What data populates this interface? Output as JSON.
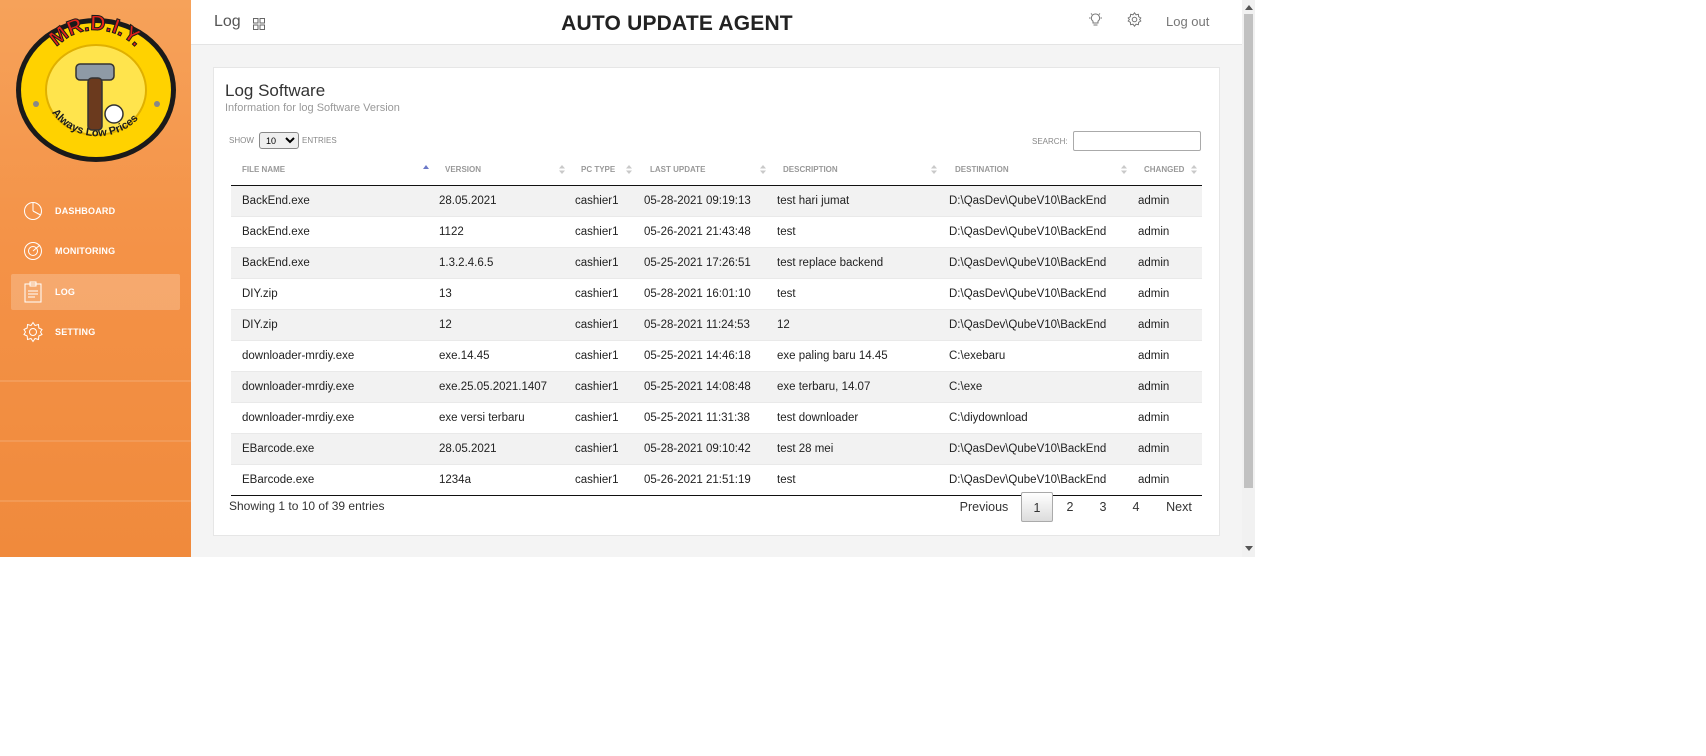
{
  "header": {
    "breadcrumb": "Log",
    "title": "AUTO UPDATE AGENT",
    "logout_label": "Log out"
  },
  "logo": {
    "top_text": "MR.D.I.Y.",
    "bottom_text": "Always Low Prices"
  },
  "sidebar": {
    "items": [
      {
        "label": "DASHBOARD",
        "icon": "pie-chart-icon",
        "active": false
      },
      {
        "label": "MONITORING",
        "icon": "target-icon",
        "active": false
      },
      {
        "label": "LOG",
        "icon": "clipboard-icon",
        "active": true
      },
      {
        "label": "SETTING",
        "icon": "gear-icon",
        "active": false
      }
    ]
  },
  "card": {
    "title": "Log Software",
    "subtitle": "Information for log Software Version",
    "show_label": "SHOW",
    "entries_value": "10",
    "entries_label": "ENTRIES",
    "search_label": "SEARCH:",
    "search_value": ""
  },
  "table": {
    "columns": [
      "FILE NAME",
      "VERSION",
      "PC TYPE",
      "LAST UPDATE",
      "DESCRIPTION",
      "DESTINATION",
      "CHANGED"
    ],
    "sorted_column": "FILE NAME",
    "rows": [
      [
        "BackEnd.exe",
        "28.05.2021",
        "cashier1",
        "05-28-2021 09:19:13",
        "test hari jumat",
        "D:\\QasDev\\QubeV10\\BackEnd",
        "admin"
      ],
      [
        "BackEnd.exe",
        "1122",
        "cashier1",
        "05-26-2021 21:43:48",
        "test",
        "D:\\QasDev\\QubeV10\\BackEnd",
        "admin"
      ],
      [
        "BackEnd.exe",
        "1.3.2.4.6.5",
        "cashier1",
        "05-25-2021 17:26:51",
        "test replace backend",
        "D:\\QasDev\\QubeV10\\BackEnd",
        "admin"
      ],
      [
        "DIY.zip",
        "13",
        "cashier1",
        "05-28-2021 16:01:10",
        "test",
        "D:\\QasDev\\QubeV10\\BackEnd",
        "admin"
      ],
      [
        "DIY.zip",
        "12",
        "cashier1",
        "05-28-2021 11:24:53",
        "12",
        "D:\\QasDev\\QubeV10\\BackEnd",
        "admin"
      ],
      [
        "downloader-mrdiy.exe",
        "exe.14.45",
        "cashier1",
        "05-25-2021 14:46:18",
        "exe paling baru 14.45",
        "C:\\exebaru",
        "admin"
      ],
      [
        "downloader-mrdiy.exe",
        "exe.25.05.2021.1407",
        "cashier1",
        "05-25-2021 14:08:48",
        "exe terbaru, 14.07",
        "C:\\exe",
        "admin"
      ],
      [
        "downloader-mrdiy.exe",
        "exe versi terbaru",
        "cashier1",
        "05-25-2021 11:31:38",
        "test downloader",
        "C:\\diydownload",
        "admin"
      ],
      [
        "EBarcode.exe",
        "28.05.2021",
        "cashier1",
        "05-28-2021 09:10:42",
        "test 28 mei",
        "D:\\QasDev\\QubeV10\\BackEnd",
        "admin"
      ],
      [
        "EBarcode.exe",
        "1234a",
        "cashier1",
        "05-26-2021 21:51:19",
        "test",
        "D:\\QasDev\\QubeV10\\BackEnd",
        "admin"
      ]
    ]
  },
  "footer": {
    "info": "Showing 1 to 10 of 39 entries",
    "previous_label": "Previous",
    "pages": [
      "1",
      "2",
      "3",
      "4"
    ],
    "current_page": "1",
    "next_label": "Next"
  },
  "colors": {
    "sidebar_orange": "#f49247",
    "logo_yellow": "#ffd200",
    "logo_red": "#e2231a"
  }
}
